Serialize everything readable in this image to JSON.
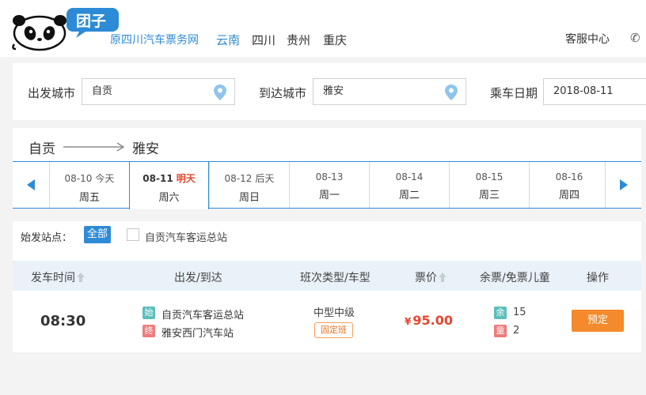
{
  "brand": {
    "name": "团子",
    "subtitle": "原四川汽车票务网"
  },
  "provinces": [
    "云南",
    "四川",
    "贵州",
    "重庆"
  ],
  "header": {
    "service_label": "客服中心",
    "phone_icon": "phone-icon"
  },
  "search": {
    "depart_label": "出发城市",
    "depart_value": "自贡",
    "arrive_label": "到达城市",
    "arrive_value": "雅安",
    "date_label": "乘车日期",
    "date_value": "2018-08-11"
  },
  "route": {
    "from": "自贡",
    "to": "雅安"
  },
  "dates": [
    {
      "date": "08-10",
      "rel": "今天",
      "weekday": "周五",
      "active": false
    },
    {
      "date": "08-11",
      "rel": "明天",
      "weekday": "周六",
      "active": true
    },
    {
      "date": "08-12",
      "rel": "后天",
      "weekday": "周日",
      "active": false
    },
    {
      "date": "08-13",
      "rel": "",
      "weekday": "周一",
      "active": false
    },
    {
      "date": "08-14",
      "rel": "",
      "weekday": "周二",
      "active": false
    },
    {
      "date": "08-15",
      "rel": "",
      "weekday": "周三",
      "active": false
    },
    {
      "date": "08-16",
      "rel": "",
      "weekday": "周四",
      "active": false
    }
  ],
  "filter": {
    "label": "始发站点：",
    "all_label": "全部",
    "station": "自贡汽车客运总站"
  },
  "table": {
    "headers": {
      "time": "发车时间",
      "stations": "出发/到达",
      "bus_type": "班次类型/车型",
      "price": "票价",
      "seats": "余票/免票儿童",
      "action": "操作"
    },
    "rows": [
      {
        "time": "08:30",
        "start_tag": "始",
        "start_station": "自贡汽车客运总站",
        "end_tag": "终",
        "end_station": "雅安西门汽车站",
        "bus_type": "中型中级",
        "schedule_badge": "固定班",
        "currency": "¥",
        "price": "95.00",
        "remain_tag": "余",
        "remain": "15",
        "child_tag": "童",
        "child": "2",
        "book_label": "预定"
      }
    ]
  },
  "colors": {
    "accent": "#2d8bd6",
    "price": "#e8452c",
    "book": "#f48a2b",
    "start_tag": "#5cbfbc",
    "end_tag": "#ef7c7c"
  }
}
